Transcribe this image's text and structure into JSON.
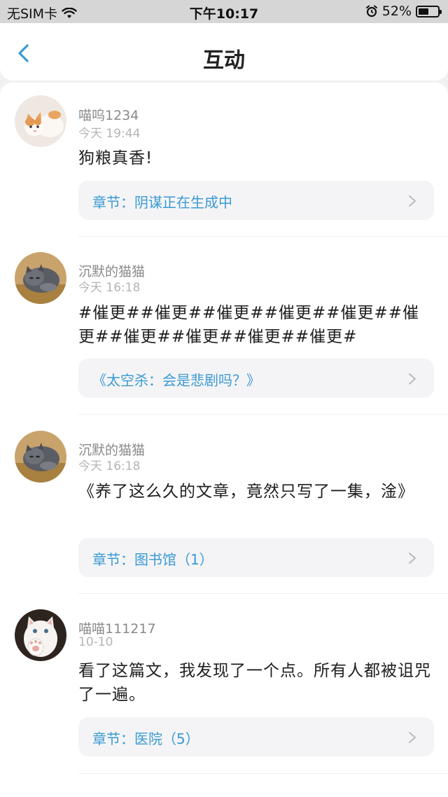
{
  "status_bar": {
    "carrier": "无SIM卡",
    "time": "下午10:17",
    "battery_text": "52%",
    "battery_level": 0.52,
    "wifi_icon": "wifi-icon",
    "alarm_icon": "alarm-icon"
  },
  "nav": {
    "back_icon": "chevron-left-icon",
    "title": "互动"
  },
  "colors": {
    "accent": "#3a9ad4",
    "background": "#f1f1f3",
    "card": "#f4f4f6"
  },
  "comments": [
    {
      "user": "喵呜1234",
      "time": "今天 19:44",
      "text": "狗粮真香!",
      "chapter": "章节：阴谋正在生成中",
      "avatar": "cat-avatar-orange-white"
    },
    {
      "user": "沉默的猫猫",
      "time": "今天 16:18",
      "text": "#催更##催更##催更##催更##催更##催更##催更##催更##催更##催更#",
      "chapter": "《太空杀：会是悲剧吗？》",
      "avatar": "cat-avatar-grey"
    },
    {
      "user": "沉默的猫猫",
      "time": "今天 16:18",
      "text": "《养了这么久的文章，竟然只写了一集，淦》",
      "chapter": "章节：图书馆（1）",
      "avatar": "cat-avatar-grey"
    },
    {
      "user": "喵喵111217",
      "time": "10-10",
      "text": "看了这篇文，我发现了一个点。所有人都被诅咒了一遍。",
      "chapter": "章节：医院（5）",
      "avatar": "cat-avatar-white-paw"
    }
  ]
}
